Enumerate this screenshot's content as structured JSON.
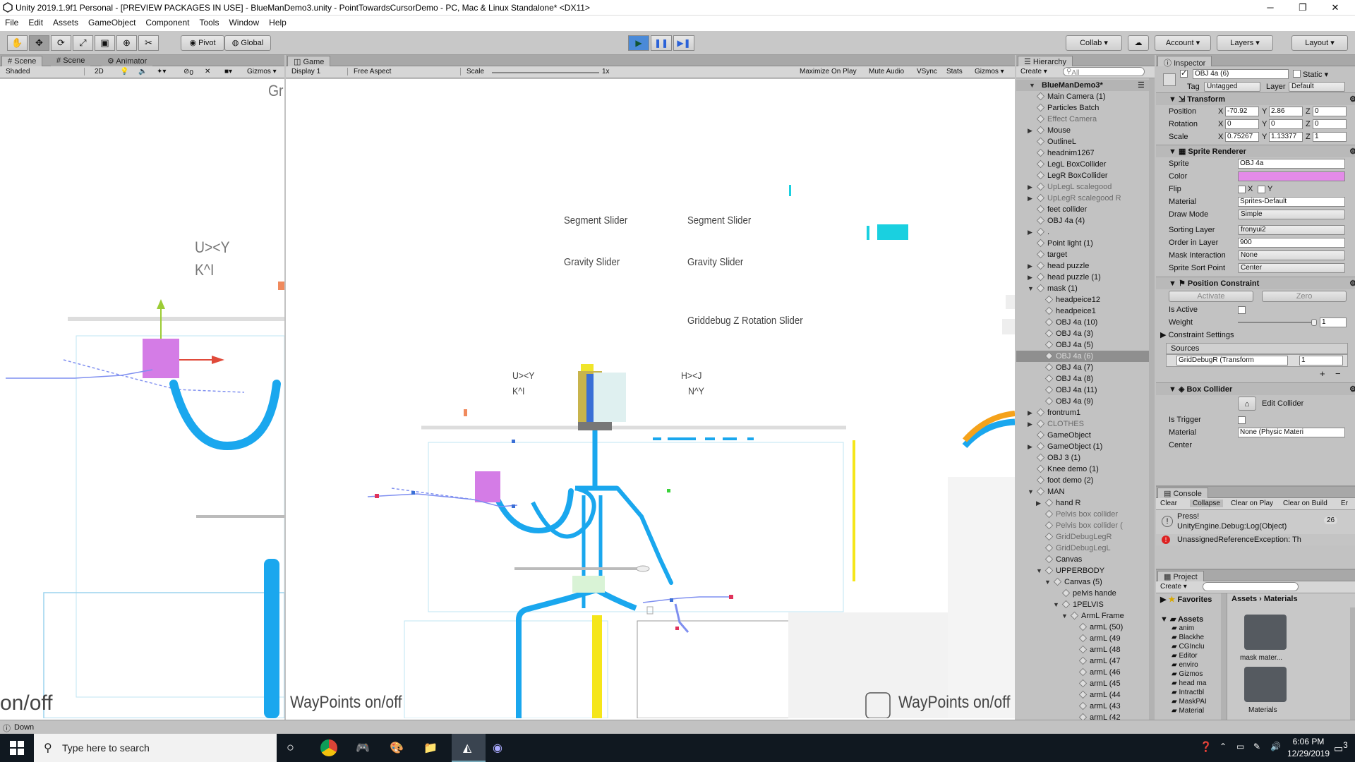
{
  "window": {
    "title": "Unity 2019.1.9f1 Personal - [PREVIEW PACKAGES IN USE] - BlueManDemo3.unity - PointTowardsCursorDemo - PC, Mac & Linux Standalone* <DX11>",
    "minimize": "─",
    "maximize": "❐",
    "close": "✕"
  },
  "menu": [
    "File",
    "Edit",
    "Assets",
    "GameObject",
    "Component",
    "Tools",
    "Window",
    "Help"
  ],
  "toolbar": {
    "pivot": "Pivot",
    "global": "Global",
    "collab": "Collab ▾",
    "account": "Account ▾",
    "layers": "Layers ▾",
    "layout": "Layout ▾"
  },
  "scene": {
    "tabs": [
      "Scene",
      "Scene",
      "Animator"
    ],
    "shading": "Shaded",
    "mode2d": "2D",
    "zero": "0",
    "gizmos": "Gizmos ▾",
    "labels": {
      "uy": "U><Y",
      "ka": "K^I",
      "gr": "Gr",
      "waypoints": "on/off"
    }
  },
  "game": {
    "tab": "Game",
    "display": "Display 1",
    "aspect": "Free Aspect",
    "scale_label": "Scale",
    "scale_value": "1x",
    "max": "Maximize On Play",
    "mute": "Mute Audio",
    "vsync": "VSync",
    "stats": "Stats",
    "gizmos": "Gizmos ▾",
    "labels": {
      "seg1": "Segment Slider",
      "seg2": "Segment Slider",
      "grav1": "Gravity Slider",
      "grav2": "Gravity Slider",
      "grid": "Griddebug Z Rotation Slider",
      "uy": "U><Y",
      "ka": "K^I",
      "hj": "H><J",
      "ny": "N^Y",
      "wp1": "WayPoints on/off",
      "wp2": "WayPoints on/off"
    }
  },
  "hierarchy": {
    "tab": "Hierarchy",
    "create": "Create ▾",
    "search": "All",
    "scene_name": "BlueManDemo3*",
    "items": [
      {
        "label": "Main Camera (1)",
        "indent": 0,
        "arrow": false,
        "dim": false
      },
      {
        "label": "Particles Batch",
        "indent": 0,
        "arrow": false,
        "dim": false
      },
      {
        "label": "Effect Camera",
        "indent": 0,
        "arrow": false,
        "dim": true
      },
      {
        "label": "Mouse",
        "indent": 0,
        "arrow": true,
        "dim": false
      },
      {
        "label": "OutlineL",
        "indent": 0,
        "arrow": false,
        "dim": false
      },
      {
        "label": "headnim1267",
        "indent": 0,
        "arrow": false,
        "dim": false
      },
      {
        "label": "LegL BoxCollider",
        "indent": 0,
        "arrow": false,
        "dim": false
      },
      {
        "label": "LegR BoxCollider",
        "indent": 0,
        "arrow": false,
        "dim": false
      },
      {
        "label": "UpLegL scalegood",
        "indent": 0,
        "arrow": true,
        "dim": true
      },
      {
        "label": "UpLegR scalegood  R",
        "indent": 0,
        "arrow": true,
        "dim": true
      },
      {
        "label": "feet collider",
        "indent": 0,
        "arrow": false,
        "dim": false
      },
      {
        "label": "OBJ 4a (4)",
        "indent": 0,
        "arrow": false,
        "dim": false
      },
      {
        "label": ".",
        "indent": 0,
        "arrow": true,
        "dim": false
      },
      {
        "label": "Point light (1)",
        "indent": 0,
        "arrow": false,
        "dim": false
      },
      {
        "label": "target",
        "indent": 0,
        "arrow": false,
        "dim": false
      },
      {
        "label": "head puzzle",
        "indent": 0,
        "arrow": true,
        "dim": false
      },
      {
        "label": "head puzzle (1)",
        "indent": 0,
        "arrow": true,
        "dim": false
      },
      {
        "label": "mask (1)",
        "indent": 0,
        "arrow": "open",
        "dim": false
      },
      {
        "label": "headpeice12",
        "indent": 1,
        "arrow": false,
        "dim": false
      },
      {
        "label": "headpeice1",
        "indent": 1,
        "arrow": false,
        "dim": false
      },
      {
        "label": "OBJ 4a (10)",
        "indent": 1,
        "arrow": false,
        "dim": false
      },
      {
        "label": "OBJ 4a (3)",
        "indent": 1,
        "arrow": false,
        "dim": false
      },
      {
        "label": "OBJ 4a (5)",
        "indent": 1,
        "arrow": false,
        "dim": false
      },
      {
        "label": "OBJ 4a (6)",
        "indent": 1,
        "arrow": false,
        "dim": false,
        "selected": true
      },
      {
        "label": "OBJ 4a (7)",
        "indent": 1,
        "arrow": false,
        "dim": false
      },
      {
        "label": "OBJ 4a (8)",
        "indent": 1,
        "arrow": false,
        "dim": false
      },
      {
        "label": "OBJ 4a (11)",
        "indent": 1,
        "arrow": false,
        "dim": false
      },
      {
        "label": "OBJ 4a (9)",
        "indent": 1,
        "arrow": false,
        "dim": false
      },
      {
        "label": "frontrum1",
        "indent": 0,
        "arrow": true,
        "dim": false
      },
      {
        "label": "CLOTHES",
        "indent": 0,
        "arrow": true,
        "dim": true
      },
      {
        "label": "GameObject",
        "indent": 0,
        "arrow": false,
        "dim": false
      },
      {
        "label": "GameObject (1)",
        "indent": 0,
        "arrow": true,
        "dim": false
      },
      {
        "label": "OBJ 3 (1)",
        "indent": 0,
        "arrow": false,
        "dim": false
      },
      {
        "label": "Knee demo (1)",
        "indent": 0,
        "arrow": false,
        "dim": false
      },
      {
        "label": "foot demo (2)",
        "indent": 0,
        "arrow": false,
        "dim": false
      },
      {
        "label": "MAN",
        "indent": 0,
        "arrow": "open",
        "dim": false
      },
      {
        "label": "hand R",
        "indent": 1,
        "arrow": true,
        "dim": false
      },
      {
        "label": "Pelvis box collider",
        "indent": 1,
        "arrow": false,
        "dim": true
      },
      {
        "label": "Pelvis box collider (",
        "indent": 1,
        "arrow": false,
        "dim": true
      },
      {
        "label": "GridDebugLegR",
        "indent": 1,
        "arrow": false,
        "dim": true
      },
      {
        "label": "GridDebugLegL",
        "indent": 1,
        "arrow": false,
        "dim": true
      },
      {
        "label": "Canvas",
        "indent": 1,
        "arrow": false,
        "dim": false
      },
      {
        "label": "UPPERBODY",
        "indent": 1,
        "arrow": "open",
        "dim": false
      },
      {
        "label": "Canvas (5)",
        "indent": 2,
        "arrow": "open",
        "dim": false
      },
      {
        "label": "pelvis hande",
        "indent": 3,
        "arrow": false,
        "dim": false
      },
      {
        "label": "1PELVIS",
        "indent": 3,
        "arrow": "open",
        "dim": false
      },
      {
        "label": "ArmL Frame",
        "indent": 4,
        "arrow": "open",
        "dim": false
      },
      {
        "label": "armL (50)",
        "indent": 5,
        "arrow": false,
        "dim": false
      },
      {
        "label": "armL (49",
        "indent": 5,
        "arrow": false,
        "dim": false
      },
      {
        "label": "armL (48",
        "indent": 5,
        "arrow": false,
        "dim": false
      },
      {
        "label": "armL (47",
        "indent": 5,
        "arrow": false,
        "dim": false
      },
      {
        "label": "armL (46",
        "indent": 5,
        "arrow": false,
        "dim": false
      },
      {
        "label": "armL (45",
        "indent": 5,
        "arrow": false,
        "dim": false
      },
      {
        "label": "armL (44",
        "indent": 5,
        "arrow": false,
        "dim": false
      },
      {
        "label": "armL (43",
        "indent": 5,
        "arrow": false,
        "dim": false
      },
      {
        "label": "armL (42",
        "indent": 5,
        "arrow": false,
        "dim": false
      }
    ]
  },
  "inspector": {
    "tab": "Inspector",
    "object_name": "OBJ 4a (6)",
    "static": "Static ▾",
    "tag_label": "Tag",
    "tag": "Untagged",
    "layer_label": "Layer",
    "layer": "Default",
    "transform": {
      "title": "Transform",
      "position": "Position",
      "rotation": "Rotation",
      "scale": "Scale",
      "px": "-70.92",
      "py": "2.86",
      "pz": "0",
      "rx": "0",
      "ry": "0",
      "rz": "0",
      "sx": "0.75267",
      "sy": "1.13377",
      "sz": "1",
      "x": "X",
      "y": "Y",
      "z": "Z"
    },
    "sprite": {
      "title": "Sprite Renderer",
      "sprite_label": "Sprite",
      "sprite": "OBJ 4a",
      "color_label": "Color",
      "color": "#e38be8",
      "flip_label": "Flip",
      "flipx": "X",
      "flipy": "Y",
      "material_label": "Material",
      "material": "Sprites-Default",
      "draw_label": "Draw Mode",
      "draw": "Simple",
      "sorting_label": "Sorting Layer",
      "sorting": "fronyui2",
      "order_label": "Order in Layer",
      "order": "900",
      "mask_label": "Mask Interaction",
      "mask": "None",
      "sortpt_label": "Sprite Sort Point",
      "sortpt": "Center"
    },
    "constraint": {
      "title": "Position Constraint",
      "activate": "Activate",
      "zero": "Zero",
      "active_label": "Is Active",
      "weight_label": "Weight",
      "weight": "1",
      "settings": "Constraint Settings",
      "sources": "Sources",
      "source": "GridDebugR (Transform",
      "source_val": "1",
      "plus": "+",
      "minus": "−"
    },
    "box": {
      "title": "Box Collider",
      "edit": "Edit Collider",
      "trigger_label": "Is Trigger",
      "material_label": "Material",
      "material": "None (Physic Materi",
      "center_label": "Center"
    }
  },
  "console": {
    "tab": "Console",
    "clear": "Clear",
    "collapse": "Collapse",
    "clear_play": "Clear on Play",
    "clear_build": "Clear on Build",
    "err": "Er",
    "msg1a": "Press!",
    "msg1b": "UnityEngine.Debug:Log(Object)",
    "count": "26",
    "msg2": "UnassignedReferenceException: Th"
  },
  "project": {
    "tab": "Project",
    "create": "Create ▾",
    "favorites": "Favorites",
    "crumb_assets": "Assets",
    "crumb_sep": "›",
    "crumb_mat": "Materials",
    "assets": "Assets",
    "folders": [
      "anim",
      "Blackhe",
      "CGInclu",
      "Editor",
      "enviro",
      "Gizmos",
      "head ma",
      "Intractbl",
      "MaskPAI",
      "Material"
    ],
    "thumbs": [
      "mask mater...",
      "Materials"
    ]
  },
  "status": {
    "text": "Down"
  },
  "taskbar": {
    "search": "Type here to search",
    "time": "6:06 PM",
    "date": "12/29/2019",
    "notif": "3"
  }
}
